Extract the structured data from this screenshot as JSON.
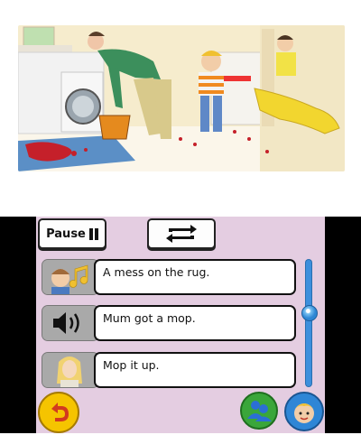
{
  "top_screen": {
    "illustration": "family-kitchen-scene"
  },
  "controls": {
    "pause_label": "Pause",
    "pause_icon": "pause-icon",
    "repeat_icon": "repeat-icon"
  },
  "lines": [
    {
      "icon": "character-music-icon",
      "text": "A mess on the rug."
    },
    {
      "icon": "speaker-icon",
      "text": "Mum got a mop."
    },
    {
      "icon": "mum-portrait-icon",
      "text": "Mop it up."
    }
  ],
  "footer": {
    "back_icon": "back-arrow-icon",
    "characters_icon": "characters-icon",
    "profile_icon": "child-avatar-icon"
  },
  "colors": {
    "panel": "#e4cde1",
    "slider": "#3c8fdc",
    "back_button": "#f5c400",
    "characters_button": "#3aa63a",
    "profile_button": "#2f86d6"
  }
}
